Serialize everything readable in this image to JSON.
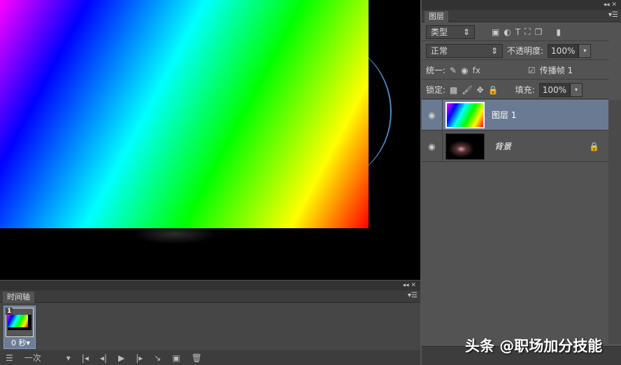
{
  "timeline": {
    "tab": "时间轴",
    "frame_number": "1",
    "frame_delay": "0 秒▾",
    "loop": "一次",
    "collapse_icon": "◂◂ ✕",
    "menu_icon": "▾☰"
  },
  "layers_panel": {
    "tab": "图层",
    "filter_kind": "类型",
    "blend_mode": "正常",
    "opacity_label": "不透明度:",
    "opacity": "100%",
    "unify_label": "统一:",
    "propagate_label": "传播帧 1",
    "propagate_checked": true,
    "lock_label": "锁定:",
    "fill_label": "填充:",
    "fill": "100%",
    "layers": [
      {
        "name": "图层 1",
        "selected": true
      },
      {
        "name": "背景",
        "locked": true
      }
    ]
  },
  "watermark": "头条 @职场加分技能"
}
